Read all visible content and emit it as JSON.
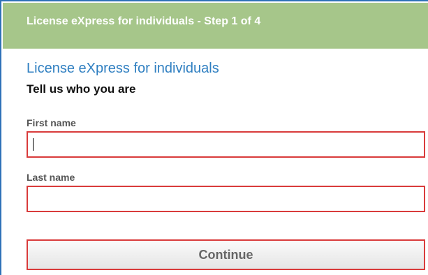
{
  "header": {
    "title": "License eXpress for individuals - Step 1 of 4"
  },
  "form": {
    "app_title": "License eXpress for individuals",
    "subtitle": "Tell us who you are",
    "first_name": {
      "label": "First name",
      "value": ""
    },
    "last_name": {
      "label": "Last name",
      "value": ""
    },
    "continue_label": "Continue"
  },
  "colors": {
    "header_background": "#a6c68a",
    "header_text": "#ffffff",
    "app_title": "#2f7fc1",
    "frame_border": "#2f71b8",
    "field_border_highlight": "#d93b3b",
    "button_text": "#666666"
  }
}
